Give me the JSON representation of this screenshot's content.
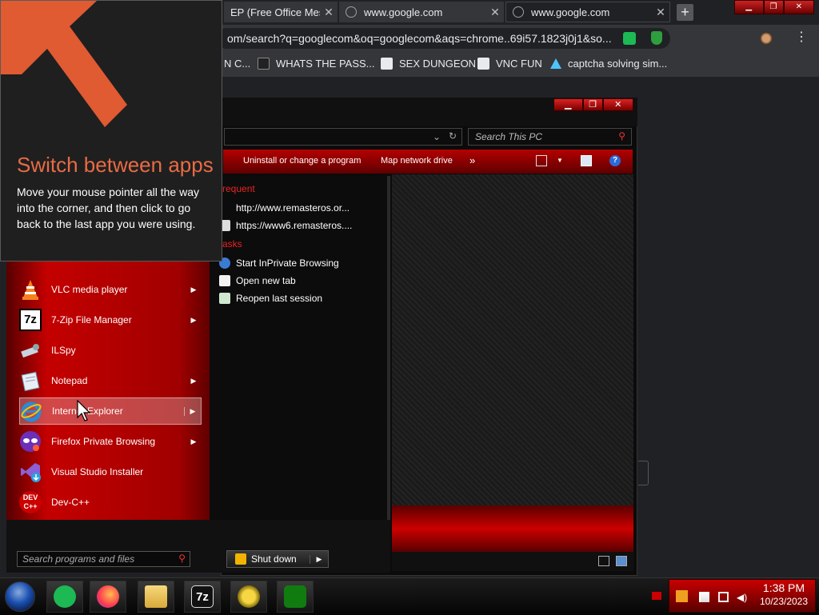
{
  "chrome": {
    "tabs": [
      {
        "title": "EP (Free Office Messen",
        "close": "✕"
      },
      {
        "title": "www.google.com",
        "close": "✕"
      },
      {
        "title": "www.google.com",
        "close": "✕"
      }
    ],
    "new_tab": "+",
    "window_buttons": [
      "▁",
      "❐",
      "✕"
    ],
    "address": "om/search?q=googlecom&oq=googlecom&aqs=chrome..69i57.1823j0j1&so...",
    "menu_glyph": "⋮",
    "bookmarks": [
      {
        "label": "N C..."
      },
      {
        "label": "WHATS THE PASS..."
      },
      {
        "label": "SEX DUNGEON"
      },
      {
        "label": "VNC FUN"
      },
      {
        "label": "captcha solving sim..."
      }
    ]
  },
  "explorer": {
    "window_buttons": [
      "▁",
      "❐",
      "✕"
    ],
    "address_dropdown": "⌄",
    "refresh": "↻",
    "search_placeholder": "Search This PC",
    "search_glyph": "⚲",
    "commands": {
      "uninstall": "Uninstall or change a program",
      "map_drive": "Map network drive",
      "more": "»"
    },
    "help": "?"
  },
  "tip": {
    "title": "Switch between apps",
    "body": "Move your mouse pointer all the way into the corner, and then click to go back to the last app you were using.",
    "accent": "#e86b45"
  },
  "start_menu": {
    "programs": [
      {
        "label": "VLC media player",
        "arrow": "▶"
      },
      {
        "label": "7-Zip File Manager",
        "arrow": "▶"
      },
      {
        "label": "ILSpy",
        "arrow": ""
      },
      {
        "label": "Notepad",
        "arrow": "▶"
      },
      {
        "label": "Internet Explorer",
        "arrow": "▶"
      },
      {
        "label": "Firefox Private Browsing",
        "arrow": "▶"
      },
      {
        "label": "Visual Studio Installer",
        "arrow": ""
      },
      {
        "label": "Dev-C++",
        "arrow": ""
      }
    ],
    "jump_list": {
      "frequent_header": "requent",
      "frequent": [
        "http://www.remasteros.or...",
        "https://www6.remasteros...."
      ],
      "tasks_header": "asks",
      "tasks": [
        "Start InPrivate Browsing",
        "Open new tab",
        "Reopen last session"
      ]
    },
    "search_placeholder": "Search programs and files",
    "search_glyph": "⚲",
    "shutdown_label": "Shut down",
    "shutdown_arrow": "▶",
    "icon_labels": {
      "sevenzip": "7z",
      "devcpp": "DEV C++"
    }
  },
  "taskbar": {
    "sevenzip_label": "7z",
    "clock_time": "1:38 PM",
    "clock_date": "10/23/2023"
  },
  "colors": {
    "accent_red": "#c40000",
    "chrome_dark": "#202124",
    "chrome_toolbar": "#35363a"
  }
}
